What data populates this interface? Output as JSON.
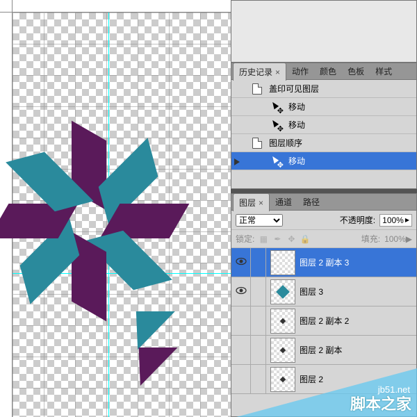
{
  "history_panel": {
    "tabs": {
      "history": "历史记录",
      "actions": "动作",
      "color": "颜色",
      "swatches": "色板",
      "styles": "样式"
    },
    "items": [
      {
        "icon": "doc",
        "label": "盖印可见图层"
      },
      {
        "icon": "move",
        "label": "移动"
      },
      {
        "icon": "move",
        "label": "移动"
      },
      {
        "icon": "doc",
        "label": "图层顺序"
      },
      {
        "icon": "move",
        "label": "移动",
        "selected": true
      }
    ]
  },
  "layers_panel": {
    "tabs": {
      "layers": "图层",
      "channels": "通道",
      "paths": "路径"
    },
    "blend_mode": "正常",
    "opacity_label": "不透明度:",
    "opacity_value": "100%",
    "lock_label": "锁定:",
    "fill_label": "填充:",
    "fill_value": "100%",
    "layers": [
      {
        "name": "图层 2 副本 3",
        "visible": true,
        "selected": true,
        "thumb": "checker"
      },
      {
        "name": "图层 3",
        "visible": true,
        "selected": false,
        "thumb": "star"
      },
      {
        "name": "图层 2 副本 2",
        "visible": false,
        "selected": false,
        "thumb": "dot"
      },
      {
        "name": "图层 2 副本",
        "visible": false,
        "selected": false,
        "thumb": "dot"
      },
      {
        "name": "图层 2",
        "visible": false,
        "selected": false,
        "thumb": "dot"
      }
    ]
  },
  "watermark": {
    "url": "jb51.net",
    "text": "脚本之家"
  },
  "colors": {
    "teal": "#2a8a9c",
    "purple": "#5a1a5a",
    "selection": "#3875d7"
  }
}
